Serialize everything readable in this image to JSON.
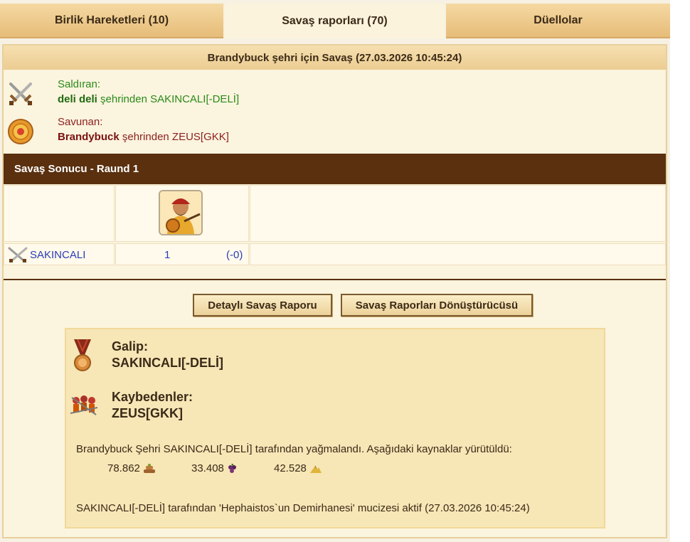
{
  "tabs": [
    {
      "label": "Birlik Hareketleri (10)"
    },
    {
      "label": "Savaş raporları (70)"
    },
    {
      "label": "Düellolar"
    }
  ],
  "report": {
    "title": "Brandybuck şehri için Savaş (27.03.2026 10:45:24)",
    "attacker": {
      "role": "Saldıran:",
      "city": "deli deli",
      "rest": " şehrinden SAKINCALI[-DELİ]"
    },
    "defender": {
      "role": "Savunan:",
      "city": "Brandybuck",
      "rest": " şehrinden ZEUS[GKK]"
    },
    "round_label": "Savaş Sonucu - Raund 1",
    "row": {
      "player": "SAKINCALI",
      "count": "1",
      "loss": "(-0)"
    }
  },
  "buttons": {
    "detail": "Detaylı Savaş Raporu",
    "converter": "Savaş Raporları Dönüştürücüsü"
  },
  "result": {
    "winner_label": "Galip:",
    "winner_name": "SAKINCALI[-DELİ]",
    "loser_label": "Kaybedenler:",
    "loser_name": "ZEUS[GKK]",
    "plunder_text": "Brandybuck Şehri SAKINCALI[-DELİ] tarafından yağmalandı. Aşağıdaki kaynaklar yürütüldü:",
    "resources": [
      {
        "amount": "78.862",
        "icon": "wood-icon"
      },
      {
        "amount": "33.408",
        "icon": "wine-icon"
      },
      {
        "amount": "42.528",
        "icon": "sulfur-icon"
      }
    ],
    "wonder_text": "SAKINCALI[-DELİ] tarafından 'Hephaistos`un Demirhanesi' mucizesi aktif (27.03.2026 10:45:24)"
  },
  "colors": {
    "round_bar": "#5a300f",
    "attacker_text": "#2a8a1a",
    "defender_text": "#8b1f1f",
    "link_blue": "#2a3cb8"
  }
}
